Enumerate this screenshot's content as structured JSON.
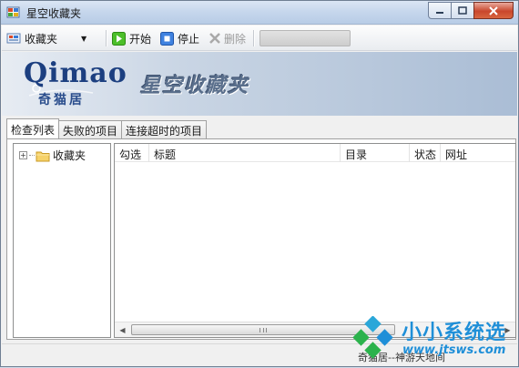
{
  "window": {
    "title": "星空收藏夹"
  },
  "toolbar": {
    "favorites_label": "收藏夹",
    "start_label": "开始",
    "stop_label": "停止",
    "delete_label": "删除",
    "progress": 0
  },
  "banner": {
    "logo_text": "Qimao",
    "logo_sub": "奇猫居",
    "title": "星空收藏夹"
  },
  "tabs": [
    {
      "label": "检查列表"
    },
    {
      "label": "失败的项目"
    },
    {
      "label": "连接超时的项目"
    }
  ],
  "tree": {
    "root_label": "收藏夹"
  },
  "list": {
    "columns": [
      "勾选",
      "标题",
      "目录",
      "状态",
      "网址"
    ]
  },
  "status": {
    "text": "奇猫居--神游天地间"
  },
  "watermark": {
    "title": "小小系统选",
    "url": "www.jtsws.com"
  },
  "colors": {
    "accent": "#1f8fd8",
    "banner": "#aabdd5",
    "start_green": "#3fb31b",
    "stop_blue": "#2f6fd8"
  }
}
